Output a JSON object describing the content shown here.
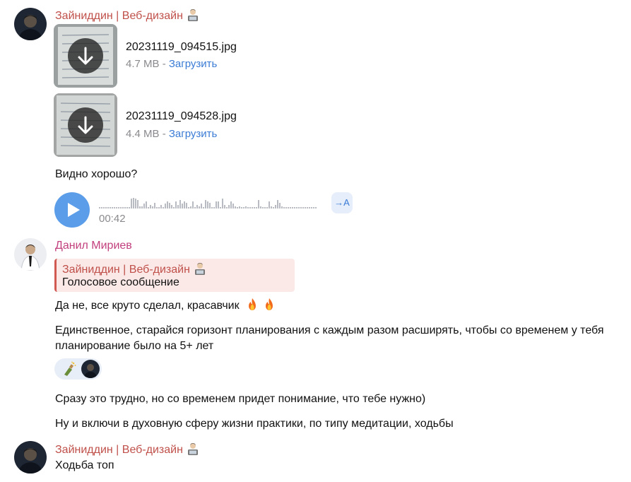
{
  "messages": {
    "m1": {
      "sender": "Зайниддин | Веб-дизайн",
      "sender_emoji": "technologist-emoji",
      "files": [
        {
          "name": "20231119_094515.jpg",
          "size": "4.7 MB",
          "sep": " - ",
          "action": "Загрузить"
        },
        {
          "name": "20231119_094528.jpg",
          "size": "4.4 MB",
          "sep": " - ",
          "action": "Загрузить"
        }
      ],
      "text": "Видно хорошо?",
      "voice": {
        "duration": "00:42",
        "transcribe_label": "→A"
      }
    },
    "m2": {
      "sender": "Данил Мириев",
      "reply": {
        "sender": "Зайниддин | Веб-дизайн",
        "text": "Голосовое сообщение"
      },
      "text1": "Да не, все круто сделал, красавчик",
      "text1_emojis": [
        "fire-emoji",
        "fire-emoji"
      ],
      "text2": "Единственное, старайся горизонт планирования с каждым разом расширять, чтобы со временем у тебя планирование было на 5+ лет",
      "reaction": {
        "emoji": "bottle-with-popping-cork-emoji"
      },
      "text3": "Сразу это трудно, но со временем придет понимание, что тебе нужно)",
      "text4": "Ну и включи в духовную сферу жизни практики, по типу медитации, ходьбы"
    },
    "m3": {
      "sender": "Зайниддин | Веб-дизайн",
      "text": "Ходьба топ"
    }
  },
  "colors": {
    "sender_red": "#c0504a",
    "sender_pink": "#c2407e",
    "link": "#3a7bd5",
    "play": "#5b9de8"
  }
}
